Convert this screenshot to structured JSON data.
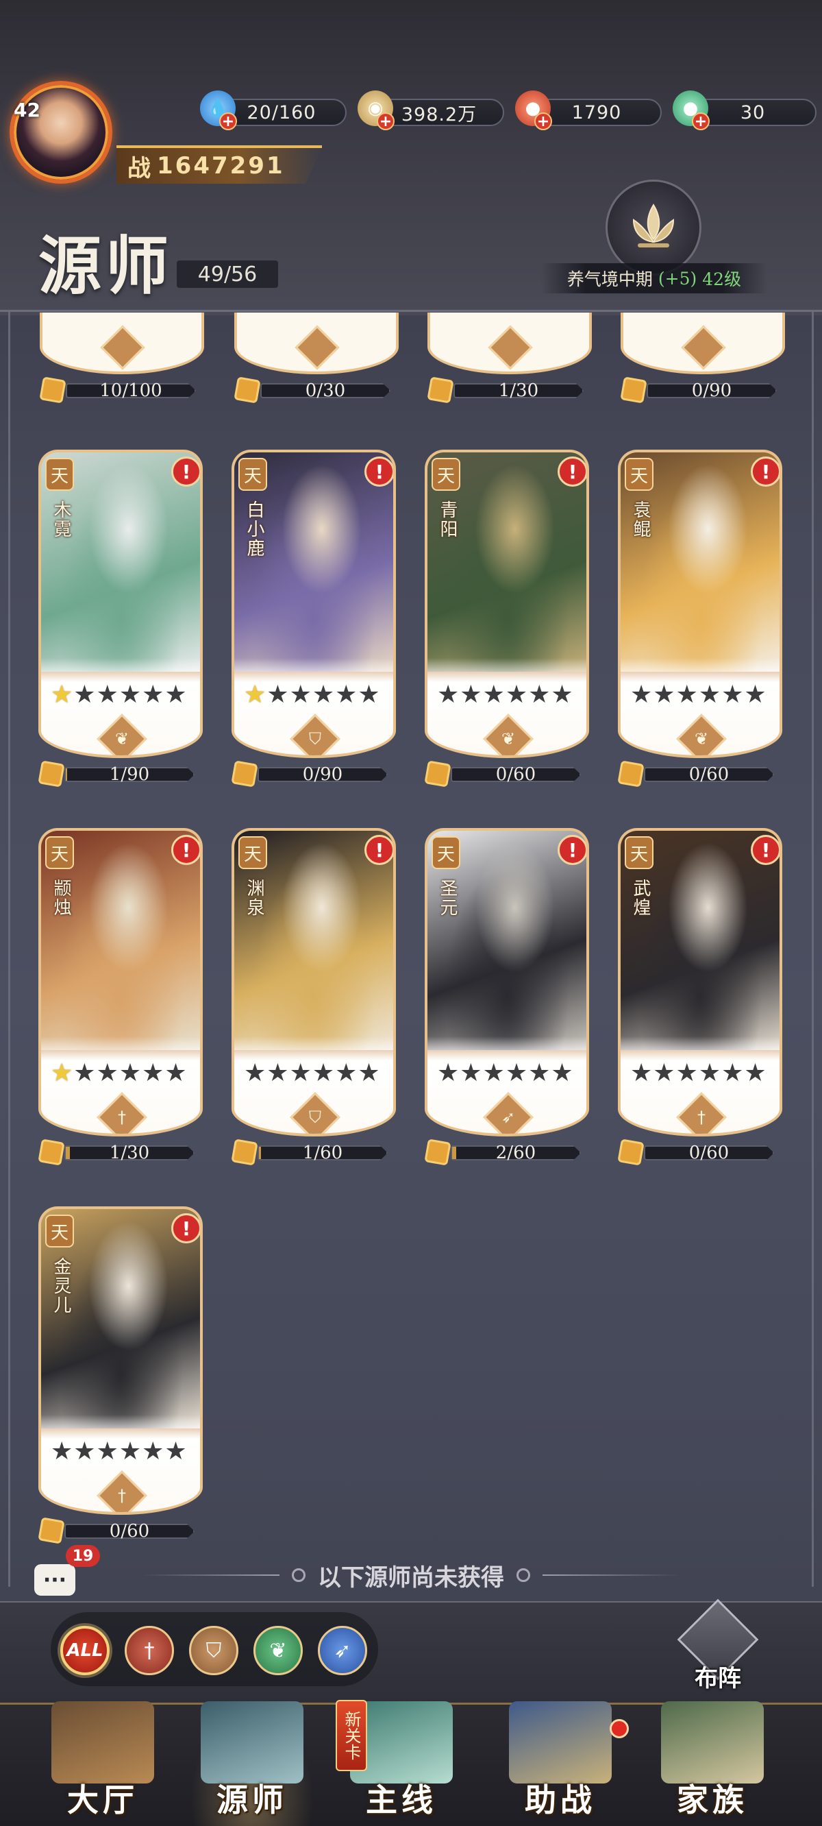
{
  "header": {
    "player_level": "42",
    "resources": [
      {
        "name": "stamina",
        "icon": "water-drop-icon",
        "value": "20/160",
        "color": "#4aa8f0"
      },
      {
        "name": "coins",
        "icon": "coin-icon",
        "value": "398.2万",
        "color": "#e6c17a"
      },
      {
        "name": "red-gem",
        "icon": "red-orb-icon",
        "value": "1790",
        "color": "#e0553a"
      },
      {
        "name": "jade",
        "icon": "jade-icon",
        "value": "30",
        "color": "#4fc08a"
      }
    ],
    "power_prefix": "战",
    "power_value": "1647291",
    "title": "源师",
    "collection": "49/56",
    "realm": {
      "name": "养气境中期",
      "bonus": "(+5)",
      "level": "42级"
    }
  },
  "top_row_fragments": [
    "10/100",
    "0/30",
    "1/30",
    "0/90"
  ],
  "top_row_roles": [
    "shield",
    "arrow",
    "leaf",
    "leaf"
  ],
  "heroes": [
    {
      "grade": "天",
      "name": "木霓",
      "stars_lit": 1,
      "stars_total": 6,
      "role": "leaf",
      "role_glyph": "❦",
      "fragments": "1/90",
      "fragment_progress": 0.011,
      "alert": "!",
      "art": [
        "#cfd9d3",
        "#6fa88f",
        "#e9ecec"
      ]
    },
    {
      "grade": "天",
      "name": "白小鹿",
      "stars_lit": 1,
      "stars_total": 6,
      "role": "shield",
      "role_glyph": "⛉",
      "fragments": "0/90",
      "fragment_progress": 0.0,
      "alert": "!",
      "art": [
        "#2e2c3c",
        "#7a6ca8",
        "#e8d8c4"
      ]
    },
    {
      "grade": "天",
      "name": "青阳",
      "stars_lit": 0,
      "stars_total": 6,
      "role": "leaf",
      "role_glyph": "❦",
      "fragments": "0/60",
      "fragment_progress": 0.0,
      "alert": "!",
      "art": [
        "#5a5a46",
        "#3f5a3a",
        "#c7b07a"
      ]
    },
    {
      "grade": "天",
      "name": "袁鲲",
      "stars_lit": 0,
      "stars_total": 6,
      "role": "leaf",
      "role_glyph": "❦",
      "fragments": "0/60",
      "fragment_progress": 0.0,
      "alert": "!",
      "art": [
        "#6a4a2e",
        "#e8b45a",
        "#f4eee4"
      ]
    },
    {
      "grade": "天",
      "name": "颛烛",
      "stars_lit": 1,
      "stars_total": 6,
      "role": "sword",
      "role_glyph": "†",
      "fragments": "1/30",
      "fragment_progress": 0.033,
      "alert": "!",
      "art": [
        "#7a3424",
        "#d9a36a",
        "#e8e0cc"
      ]
    },
    {
      "grade": "天",
      "name": "渊泉",
      "stars_lit": 0,
      "stars_total": 6,
      "role": "shield",
      "role_glyph": "⛉",
      "fragments": "1/60",
      "fragment_progress": 0.017,
      "alert": "!",
      "art": [
        "#1e1c22",
        "#d8b060",
        "#efe6d6"
      ]
    },
    {
      "grade": "天",
      "name": "圣元",
      "stars_lit": 0,
      "stars_total": 6,
      "role": "arrow",
      "role_glyph": "➶",
      "fragments": "2/60",
      "fragment_progress": 0.033,
      "alert": "!",
      "art": [
        "#e8e8ea",
        "#2a2a30",
        "#c9c4bc"
      ]
    },
    {
      "grade": "天",
      "name": "武煌",
      "stars_lit": 0,
      "stars_total": 6,
      "role": "sword",
      "role_glyph": "†",
      "fragments": "0/60",
      "fragment_progress": 0.0,
      "alert": "!",
      "art": [
        "#4a3424",
        "#2c2a2e",
        "#e4dcd0"
      ]
    },
    {
      "grade": "天",
      "name": "金灵儿",
      "stars_lit": 0,
      "stars_total": 6,
      "role": "sword",
      "role_glyph": "†",
      "fragments": "0/60",
      "fragment_progress": 0.0,
      "alert": "!",
      "art": [
        "#c9a25e",
        "#2a2a2e",
        "#ece4d8"
      ]
    }
  ],
  "unobtained_label": "以下源师尚未获得",
  "chat": {
    "icon": "chat-bubble-icon",
    "badge": "19",
    "glyph": "···"
  },
  "filters": [
    {
      "name": "all",
      "label": "ALL",
      "active": true
    },
    {
      "name": "sword",
      "glyph": "†",
      "color": "#c24a3a"
    },
    {
      "name": "shield",
      "glyph": "⛉",
      "color": "#b07a4a"
    },
    {
      "name": "leaf",
      "glyph": "❦",
      "color": "#3f9a5a"
    },
    {
      "name": "arrow",
      "glyph": "➶",
      "color": "#3f6fc4"
    }
  ],
  "formation_label": "布阵",
  "nav": [
    {
      "name": "hall",
      "label": "大厅",
      "active": false,
      "art": [
        "#6a4e34",
        "#b98a54"
      ]
    },
    {
      "name": "masters",
      "label": "源师",
      "active": true,
      "art": [
        "#3c5e6a",
        "#9fc0c4"
      ]
    },
    {
      "name": "main",
      "label": "主线",
      "active": false,
      "art": [
        "#3e7a70",
        "#b6ddd0"
      ],
      "new_tag": "新关卡"
    },
    {
      "name": "assist",
      "label": "助战",
      "active": false,
      "art": [
        "#3e5a8a",
        "#c9b27a"
      ],
      "dot": true
    },
    {
      "name": "clan",
      "label": "家族",
      "active": false,
      "art": [
        "#4e6a4a",
        "#d4c7a0"
      ]
    }
  ]
}
